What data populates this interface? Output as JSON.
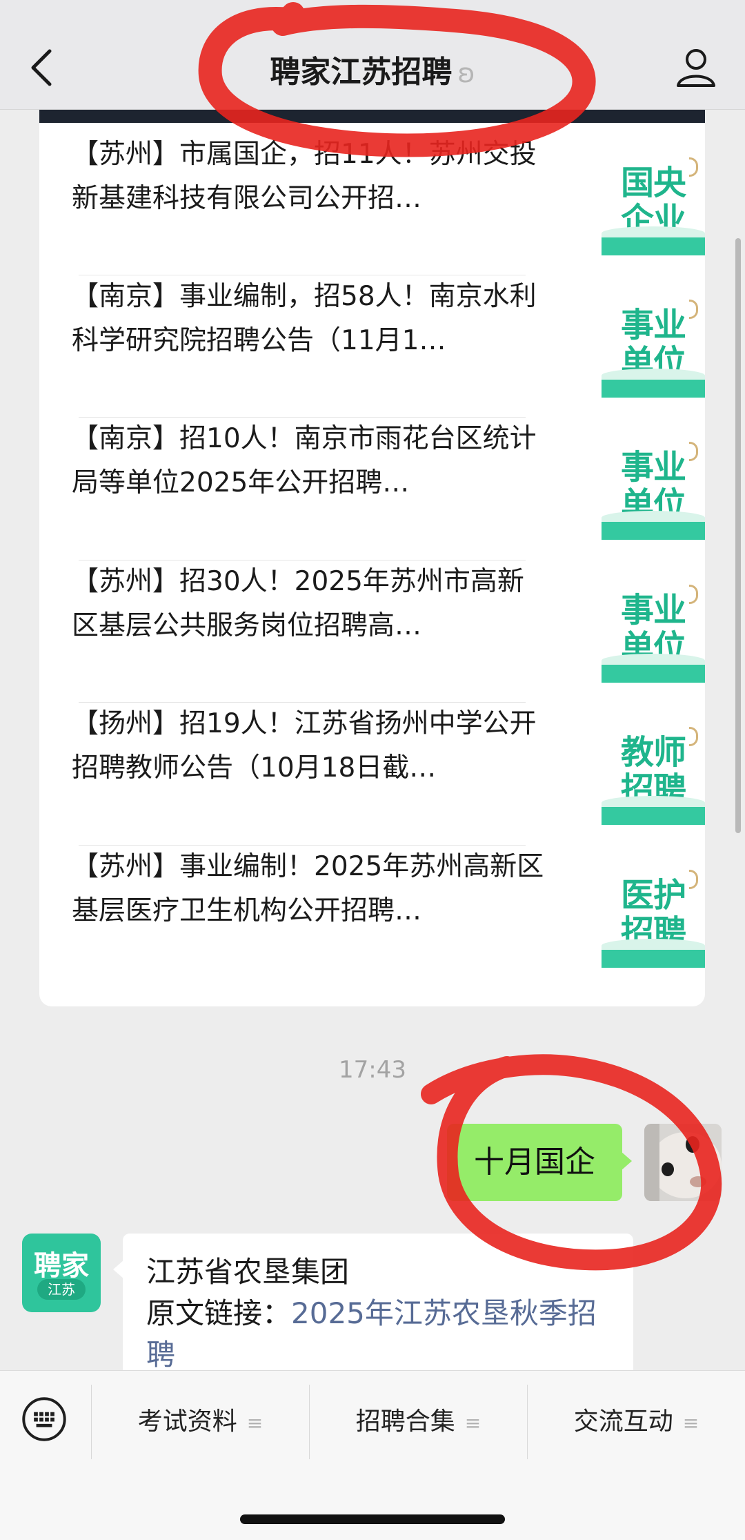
{
  "header": {
    "title": "聘家江苏招聘",
    "ear_glyph": "ʚ"
  },
  "articles": [
    {
      "text": "【苏州】市属国企，招11人！苏州交投新基建科技有限公司公开招…",
      "thumb": "国央企业"
    },
    {
      "text": "【南京】事业编制，招58人！南京水利科学研究院招聘公告（11月1…",
      "thumb": "事业单位"
    },
    {
      "text": "【南京】招10人！南京市雨花台区统计局等单位2025年公开招聘…",
      "thumb": "事业单位"
    },
    {
      "text": "【苏州】招30人！2025年苏州市高新区基层公共服务岗位招聘高…",
      "thumb": "事业单位"
    },
    {
      "text": "【扬州】招19人！江苏省扬州中学公开招聘教师公告（10月18日截…",
      "thumb": "教师招聘"
    },
    {
      "text": "【苏州】事业编制！2025年苏州高新区基层医疗卫生机构公开招聘…",
      "thumb": "医护招聘"
    }
  ],
  "chat": {
    "timestamp": "17:43",
    "outgoing": "十月国企",
    "incoming_line1": "江苏省农垦集团",
    "incoming_prefix": "原文链接：",
    "incoming_link": "2025年江苏农垦秋季招聘",
    "brand_avatar_main": "聘家",
    "brand_avatar_sub": "江苏"
  },
  "menu": {
    "items": [
      "考试资料",
      "招聘合集",
      "交流互动"
    ],
    "hamburger": "≡"
  },
  "colors": {
    "thumb_green": "#1fb58c",
    "bubble_green": "#95ec69",
    "link_blue": "#576b95",
    "annotation_red": "#e8251f"
  }
}
